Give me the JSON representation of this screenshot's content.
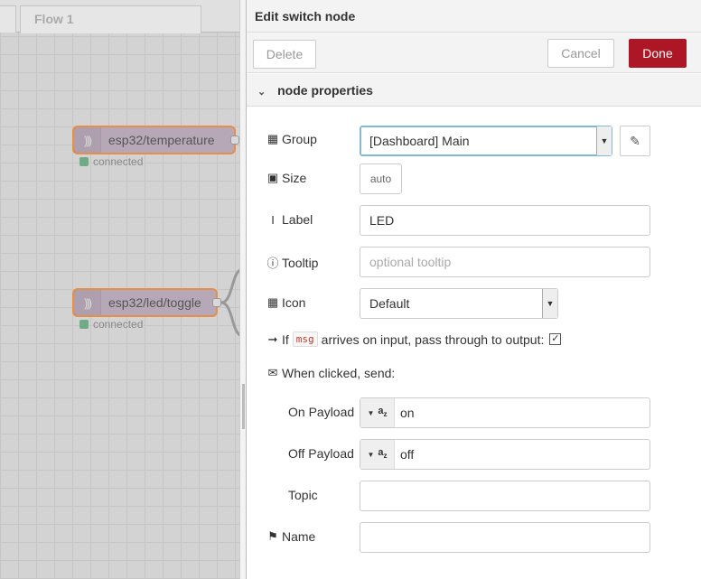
{
  "workspace": {
    "tab_label": "Flow 1",
    "nodes": [
      {
        "label": "esp32/temperature",
        "status": "connected",
        "icon": "wifi-signal-icon"
      },
      {
        "label": "esp32/led/toggle",
        "status": "connected",
        "icon": "wifi-signal-icon"
      }
    ],
    "node_color": "#b7a8b7",
    "selected_border_color": "#e58f4a",
    "status_color": "#6fab84"
  },
  "tray": {
    "title": "Edit switch node",
    "buttons": {
      "delete": "Delete",
      "cancel": "Cancel",
      "done": "Done"
    },
    "accent_color": "#ad1625",
    "section_title": "node properties",
    "form": {
      "group": {
        "label": "Group",
        "icon": "table-icon",
        "value": "[Dashboard] Main"
      },
      "size": {
        "label": "Size",
        "icon": "resize-icon",
        "value": "auto"
      },
      "label": {
        "label": "Label",
        "icon": "text-cursor-icon",
        "value": "LED"
      },
      "tooltip": {
        "label": "Tooltip",
        "icon": "info-circle-icon",
        "placeholder": "optional tooltip"
      },
      "icon": {
        "label": "Icon",
        "icon": "picture-icon",
        "value": "Default"
      },
      "passthrough": {
        "prefix": "If",
        "code": "msg",
        "text": "arrives on input, pass through to output:",
        "checked": true
      },
      "when_clicked": {
        "label": "When clicked, send:",
        "icon": "envelope-icon"
      },
      "on_payload": {
        "label": "On Payload",
        "type": "string",
        "value": "on"
      },
      "off_payload": {
        "label": "Off Payload",
        "type": "string",
        "value": "off"
      },
      "topic": {
        "label": "Topic",
        "value": ""
      },
      "name": {
        "label": "Name",
        "icon": "tag-icon",
        "value": ""
      }
    }
  }
}
